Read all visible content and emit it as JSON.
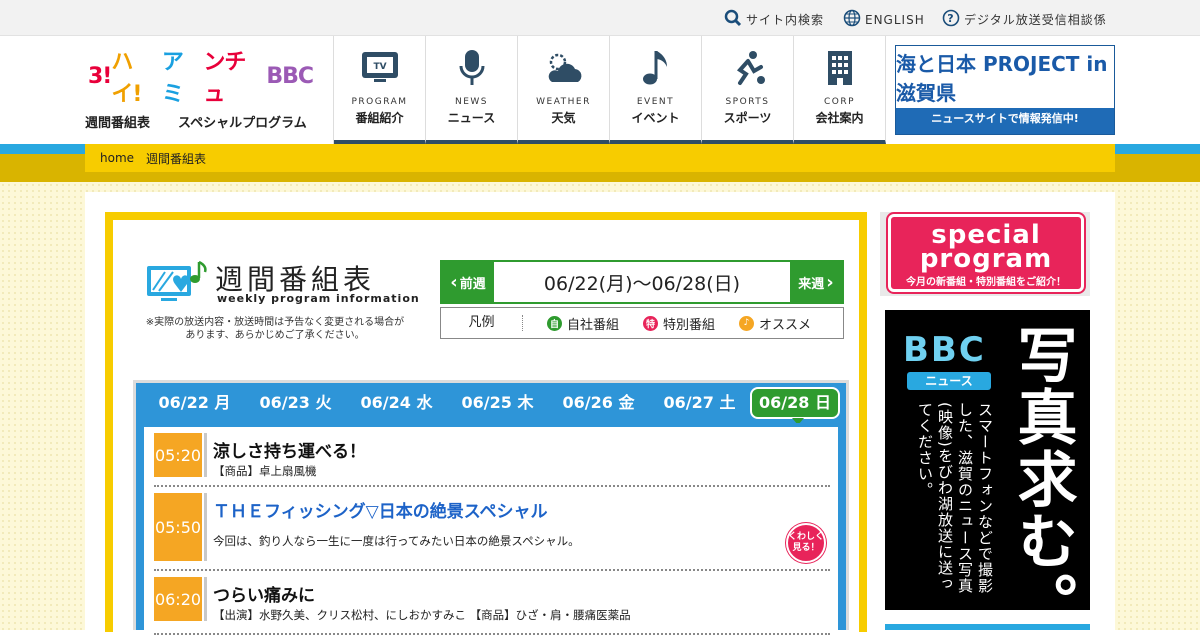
{
  "topbar": {
    "search": "サイト内検索",
    "english": "ENGLISH",
    "digital": "デジタル放送受信相談係"
  },
  "header": {
    "logo_alt": "3!ハイ!アミンチュBBC",
    "sublinks": [
      "週間番組表",
      "スペシャルプログラム"
    ],
    "nav": [
      {
        "en": "PROGRAM",
        "jp": "番組紹介",
        "icon": "tv-icon"
      },
      {
        "en": "NEWS",
        "jp": "ニュース",
        "icon": "microphone-icon"
      },
      {
        "en": "WEATHER",
        "jp": "天気",
        "icon": "weather-icon"
      },
      {
        "en": "EVENT",
        "jp": "イベント",
        "icon": "music-note-icon"
      },
      {
        "en": "SPORTS",
        "jp": "スポーツ",
        "icon": "sports-icon"
      },
      {
        "en": "CORP",
        "jp": "会社案内",
        "icon": "building-icon"
      }
    ],
    "banner_umi": {
      "title": "海と日本 PROJECT in 滋賀県",
      "caption": "ニュースサイトで情報発信中!"
    }
  },
  "breadcrumb": [
    "home",
    "週間番組表"
  ],
  "page": {
    "title_jp": "週間番組表",
    "title_en": "weekly program information",
    "notice": "※実際の放送内容・放送時間は予告なく変更される場合があります、あらかじめご了承ください。"
  },
  "week_nav": {
    "prev": "前週",
    "next": "来週",
    "range": "06/22(月)～06/28(日)"
  },
  "legend": {
    "label": "凡例",
    "items": [
      {
        "mark": "自",
        "text": "自社番組",
        "color": "#2f9b2f"
      },
      {
        "mark": "特",
        "text": "特別番組",
        "color": "#e8245a"
      },
      {
        "mark": "♪",
        "text": "オススメ",
        "color": "#f5a623"
      }
    ]
  },
  "days": [
    "06/22 月",
    "06/23 火",
    "06/24 水",
    "06/25 木",
    "06/26 金",
    "06/27 土",
    "06/28 日"
  ],
  "active_day": "06/28 日",
  "programs": [
    {
      "time": "05:20",
      "title": "涼しさ持ち運べる！",
      "desc": "【商品】卓上扇風機"
    },
    {
      "time": "05:50",
      "title": "ＴＨＥフィッシング▽日本の絶景スペシャル",
      "desc": "今回は、釣り人なら一生に一度は行ってみたい日本の絶景スペシャル。",
      "more": "くわしく見る！"
    },
    {
      "time": "06:20",
      "title": "つらい痛みに",
      "desc": "【出演】水野久美、クリス松村、にしおかすみこ 【商品】ひざ・肩・腰痛医薬品"
    }
  ],
  "side": {
    "special_title": "special program",
    "special_caption": "今月の新番組・特別番組をご紹介！",
    "photo_brand": "BBC",
    "photo_sub": "ニュース",
    "photo_big": "写真求む。",
    "photo_text": "スマートフォンなどで撮影した、滋賀のニュース写真(映像)をびわ湖放送に送ってください。"
  },
  "colors": {
    "accent_yellow": "#f7cc00",
    "accent_blue": "#29a8e0",
    "nav_green": "#2f9b2f",
    "time_orange": "#f5a623"
  }
}
